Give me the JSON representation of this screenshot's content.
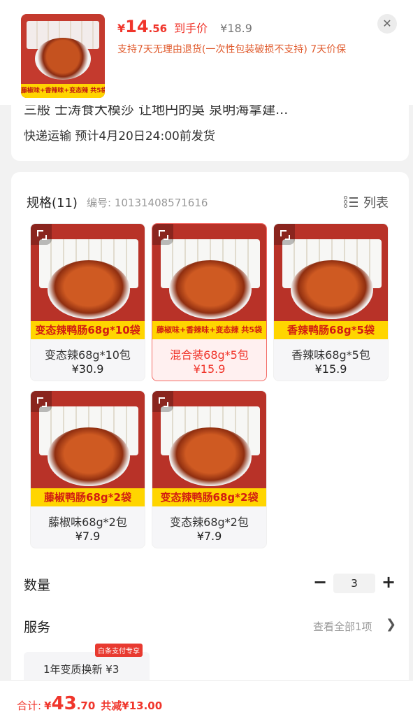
{
  "header": {
    "price_symbol": "¥",
    "price_int": "14",
    "price_dec": ".56",
    "price_tag": "到手价",
    "original_price": "¥18.9",
    "policy": "支持7天无理由退货(一次性包装破损不支持) 7天价保",
    "thumb_band": "藤椒味+香辣味+变态辣 共5袋"
  },
  "shipping": {
    "cut_off_text": "三般 士涛食大模莎 让地円的吳   泉明海拿建...",
    "text": "快递运输 预计4月20日24:00前发货"
  },
  "spec": {
    "title": "规格(11)",
    "code": "编号: 10131408571616",
    "list_label": "列表",
    "items": [
      {
        "band": "变态辣鸭肠68g*10袋",
        "name": "变态辣68g*10包",
        "price": "¥30.9",
        "selected": false
      },
      {
        "band": "藤椒味+香辣味+变态辣 共5袋",
        "name": "混合装68g*5包",
        "price": "¥15.9",
        "selected": true
      },
      {
        "band": "香辣鸭肠68g*5袋",
        "name": "香辣味68g*5包",
        "price": "¥15.9",
        "selected": false
      },
      {
        "band": "藤椒鸭肠68g*2袋",
        "name": "藤椒味68g*2包",
        "price": "¥7.9",
        "selected": false
      },
      {
        "band": "变态辣鸭肠68g*2袋",
        "name": "变态辣68g*2包",
        "price": "¥7.9",
        "selected": false
      }
    ]
  },
  "quantity": {
    "label": "数量",
    "minus": "−",
    "value": "3",
    "plus": "+"
  },
  "service": {
    "label": "服务",
    "view_all": "查看全部1项",
    "chevron": "❯",
    "item_text": "1年变质换新  ¥3",
    "badge": "白条支付专享"
  },
  "footer": {
    "label": "合计:",
    "symbol": "¥",
    "int": "43",
    "dec": ".70",
    "save": "共减¥13.00"
  },
  "colors": {
    "accent": "#f0352b",
    "band_yellow": "#ffd500",
    "product_red": "#b83228"
  }
}
